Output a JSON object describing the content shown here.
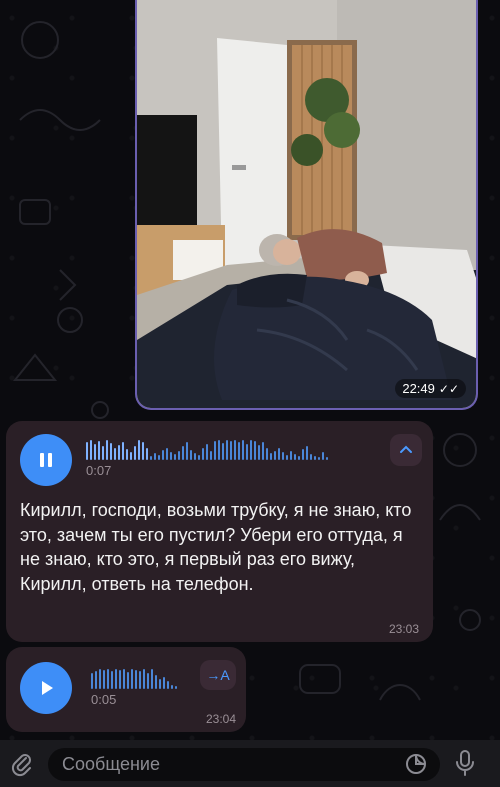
{
  "photo_message": {
    "time": "22:49",
    "status_icon": "double-check-icon"
  },
  "voice_message_1": {
    "state": "playing",
    "duration": "0:07",
    "transcript": "Кирилл, господи, возьми трубку, я не знаю, кто это, зачем ты его пустил? Убери его оттуда, я не знаю, кто это, я первый раз его вижу, Кирилл, ответь на телефон.",
    "time": "23:03",
    "collapse_icon": "chevron-up-icon"
  },
  "voice_message_2": {
    "state": "paused",
    "duration": "0:05",
    "transcribe_label": "→A",
    "time": "23:04"
  },
  "input_bar": {
    "placeholder": "Сообщение",
    "attach_icon": "paperclip-icon",
    "sticker_icon": "sticker-icon",
    "mic_icon": "microphone-icon"
  },
  "colors": {
    "accent": "#3e8ef7",
    "bubble": "#2a1f26",
    "background": "#0b0b0f"
  }
}
